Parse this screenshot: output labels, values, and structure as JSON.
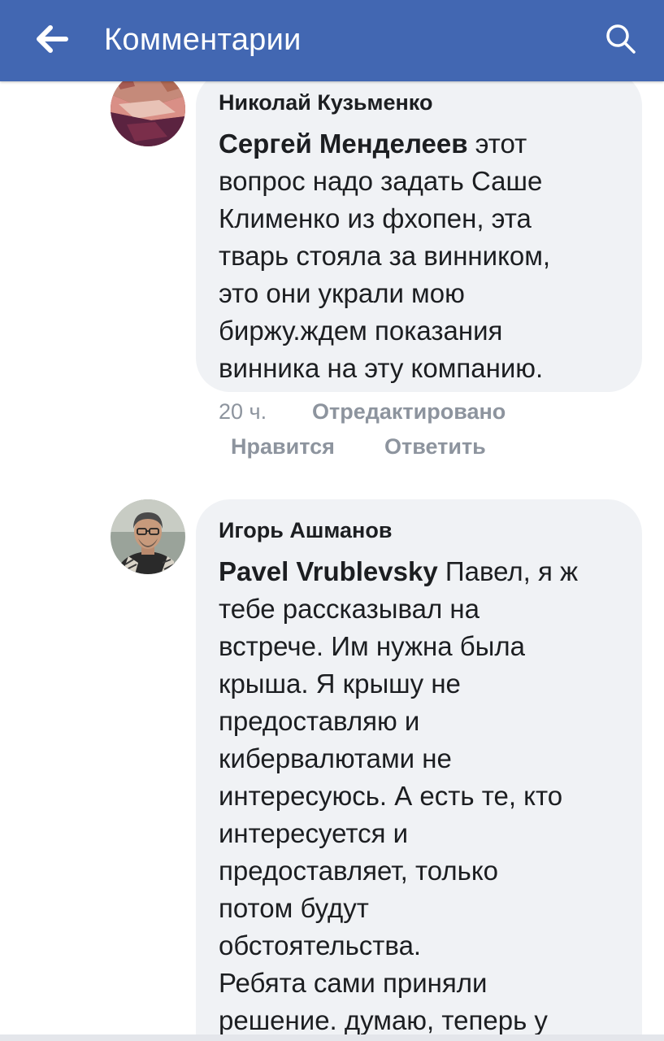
{
  "header": {
    "title": "Комментарии",
    "back_icon": "arrow-left-icon",
    "search_icon": "search-icon",
    "bg_color": "#4267b2"
  },
  "comments": [
    {
      "author": "Николай Кузьменко",
      "mention": "Сергей Менделеев",
      "first_line_rest": " этот",
      "lines": [
        "вопрос надо задать Саше",
        "Клименко из фхопен, эта",
        "тварь стояла за винником,",
        "это они украли мою",
        "биржу.ждем показания",
        "винника на эту компанию."
      ],
      "time": "20 ч.",
      "edited": "Отредактировано",
      "like": "Нравится",
      "reply": "Ответить"
    },
    {
      "author": "Игорь Ашманов",
      "mention": "Pavel Vrublevsky",
      "first_line_rest": " Павел, я ж",
      "lines": [
        "тебе рассказывал на",
        "встрече. Им нужна была",
        "крыша. Я крышу не",
        "предоставляю и",
        "кибервалютами не",
        "интересуюсь. А есть те, кто",
        "интересуется и",
        "предоставляет, только",
        "потом будут",
        "обстоятельства.",
        "Ребята сами приняли",
        "решение. думаю, теперь у"
      ]
    }
  ]
}
